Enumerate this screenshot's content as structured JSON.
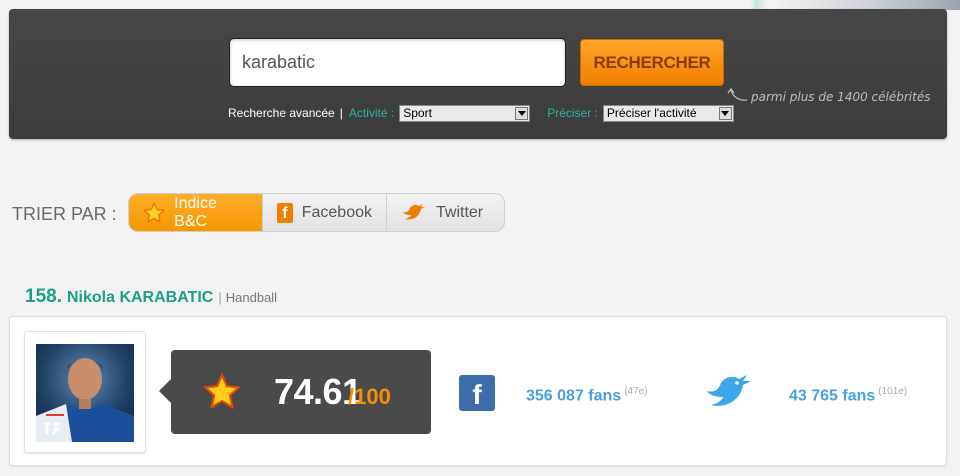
{
  "search": {
    "value": "karabatic",
    "button_label": "RECHERCHER",
    "hint": "parmi plus de 1400 célébrités",
    "advanced_label": "Recherche avancée",
    "separator": "|",
    "activity_label": "Activité :",
    "activity_value": "Sport",
    "precise_label": "Préciser :",
    "precise_value": "Préciser l'activité"
  },
  "sort": {
    "label": "TRIER PAR :",
    "tabs": [
      {
        "label": "Indice B&C",
        "icon": "star-icon",
        "active": true
      },
      {
        "label": "Facebook",
        "icon": "facebook-icon",
        "active": false
      },
      {
        "label": "Twitter",
        "icon": "twitter-bird-icon",
        "active": false
      }
    ]
  },
  "result": {
    "rank": "158.",
    "name": "Nikola KARABATIC",
    "separator": "|",
    "category": "Handball",
    "score": "74.61",
    "score_max": "/100",
    "facebook_fans": "356 087 fans",
    "facebook_rank": "(47e)",
    "twitter_fans": "43 765 fans",
    "twitter_rank": "(101e)"
  },
  "colors": {
    "accent_orange": "#f59700",
    "teal": "#1c9f87",
    "link_blue": "#4a9fdf",
    "panel_dark": "#444444"
  }
}
